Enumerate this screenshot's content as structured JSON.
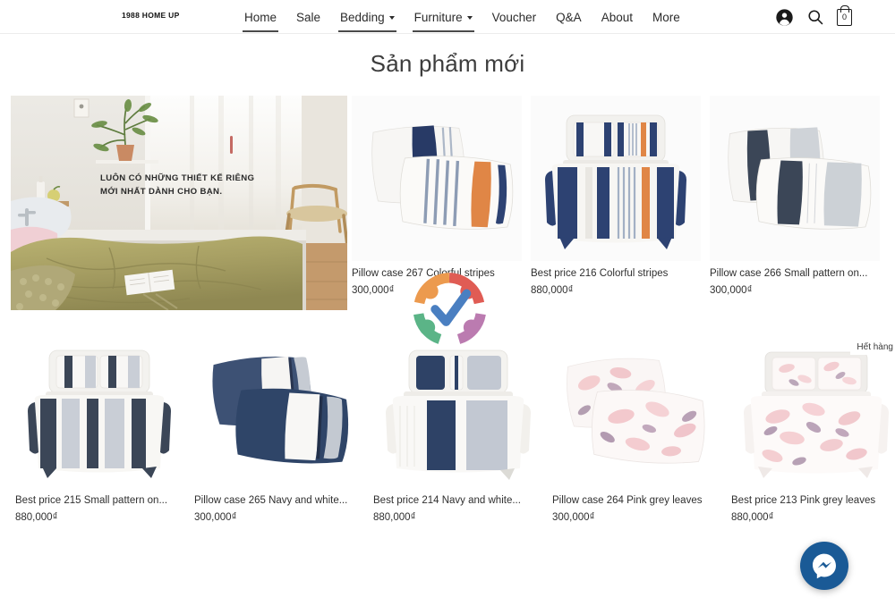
{
  "header": {
    "logo": "1988 HOME UP",
    "nav": [
      {
        "label": "Home",
        "active": true,
        "has_dropdown": false
      },
      {
        "label": "Sale",
        "active": false,
        "has_dropdown": false
      },
      {
        "label": "Bedding",
        "active": true,
        "has_dropdown": true
      },
      {
        "label": "Furniture",
        "active": true,
        "has_dropdown": true
      },
      {
        "label": "Voucher",
        "active": false,
        "has_dropdown": false
      },
      {
        "label": "Q&A",
        "active": false,
        "has_dropdown": false
      },
      {
        "label": "About",
        "active": false,
        "has_dropdown": false
      },
      {
        "label": "More",
        "active": false,
        "has_dropdown": false
      }
    ],
    "icons": {
      "account": "account-icon",
      "search": "search-icon",
      "cart": "shopping-bag-icon"
    },
    "cart_count": "0"
  },
  "page": {
    "title": "Sản phẩm mới"
  },
  "hero": {
    "text": "LUÔN CÓ NHỮNG THIẾT KẾ RIÊNG\nMỚI NHẤT DÀNH CHO BẠN.",
    "alt": "bedroom-with-olive-blanket"
  },
  "products": {
    "row1": [
      {
        "title": "Pillow case 267 Colorful stripes",
        "price": "300,000₫",
        "image": "pillow-pair-navy-orange-stripes",
        "out_of_stock": false
      },
      {
        "title": "Best price 216 Colorful stripes",
        "price": "880,000₫",
        "image": "bedding-set-navy-orange-stripes",
        "out_of_stock": false
      },
      {
        "title": "Pillow case 266 Small pattern on...",
        "price": "300,000₫",
        "image": "pillow-pair-grey-navy-blocks",
        "out_of_stock": false
      }
    ],
    "row2": [
      {
        "title": "Best price 215 Small pattern on...",
        "price": "880,000₫",
        "image": "bedding-set-grey-navy-stripes",
        "out_of_stock": false
      },
      {
        "title": "Pillow case 265 Navy and white...",
        "price": "300,000₫",
        "image": "pillow-pair-navy-white",
        "out_of_stock": false
      },
      {
        "title": "Best price 214 Navy and white...",
        "price": "880,000₫",
        "image": "bedding-set-navy-white",
        "out_of_stock": false
      },
      {
        "title": "Pillow case 264 Pink grey leaves",
        "price": "300,000₫",
        "image": "pillow-pair-pink-leaves",
        "out_of_stock": false
      },
      {
        "title": "Best price 213 Pink grey leaves",
        "price": "880,000₫",
        "image": "bedding-set-pink-leaves",
        "out_of_stock": true,
        "badge": "Hết hàng"
      }
    ]
  },
  "overlays": {
    "trust_badge": "verified-trust-badge",
    "messenger": "facebook-messenger-icon"
  },
  "colors": {
    "navy": "#2d4272",
    "orange": "#e8833f",
    "grey": "#9aa3b0",
    "pink": "#e8a6ad",
    "messenger_blue": "#1a5a96",
    "text": "#2f2f2f"
  }
}
